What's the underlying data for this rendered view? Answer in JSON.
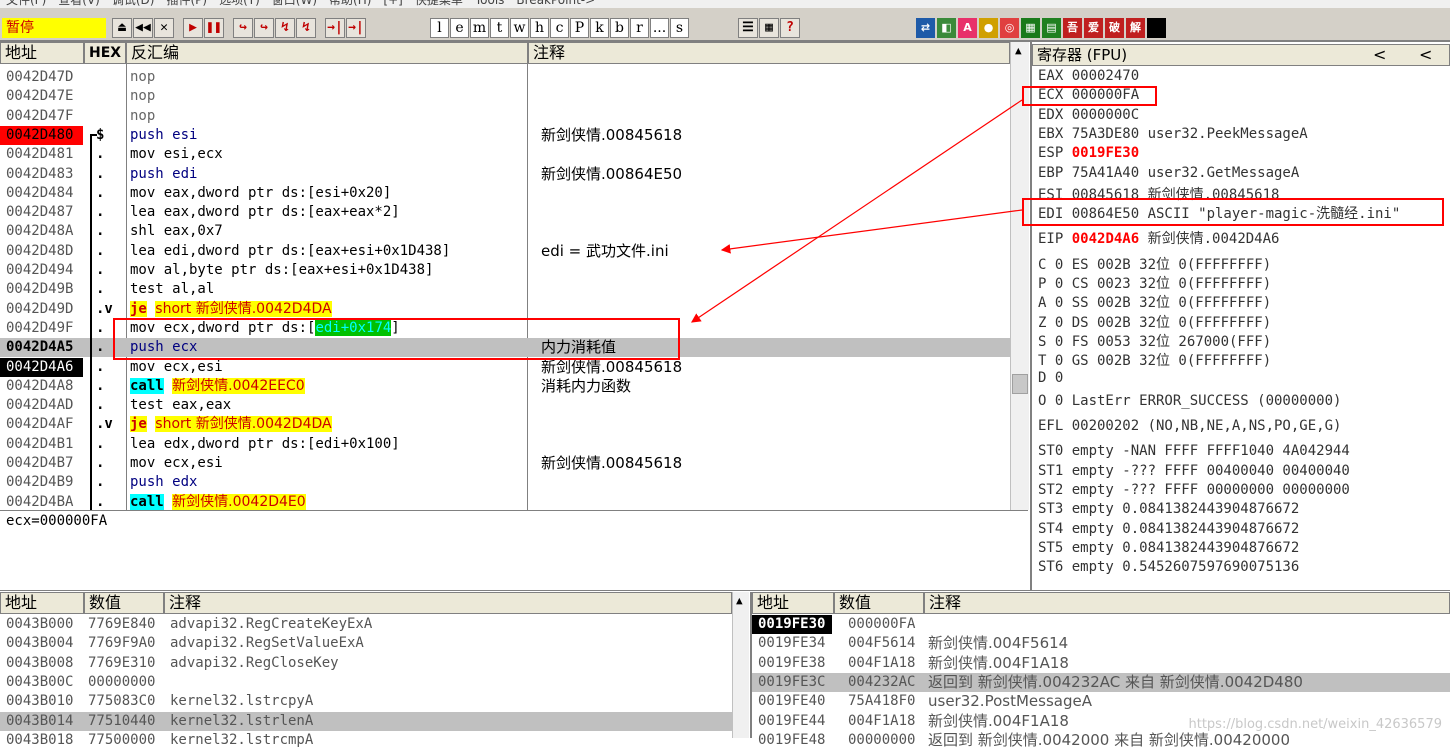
{
  "menubar": [
    "文件(F)",
    "查看(V)",
    "调试(D)",
    "插件(P)",
    "选项(T)",
    "窗口(W)",
    "帮助(H)",
    "[+]",
    "快捷菜单",
    "Tools",
    "BreakPoint->"
  ],
  "status": "暂停",
  "toolbar": {
    "nav": [
      "⏏",
      "◀◀",
      "✕",
      "▶",
      "❚❚",
      "↪",
      "↪",
      "↯",
      "↯",
      "→|",
      "→|"
    ],
    "letters": [
      "l",
      "e",
      "m",
      "t",
      "w",
      "h",
      "c",
      "P",
      "k",
      "b",
      "r",
      "...",
      "s"
    ],
    "misc": [
      "☰",
      "▦",
      "?"
    ],
    "plugins": [
      {
        "t": "⇄",
        "c": "#1e5aa8"
      },
      {
        "t": "◧",
        "c": "#3a8a3a"
      },
      {
        "t": "A",
        "c": "#e8306a"
      },
      {
        "t": "●",
        "c": "#d0a000"
      },
      {
        "t": "◎",
        "c": "#e04040"
      },
      {
        "t": "▦",
        "c": "#1a7a1a"
      },
      {
        "t": "▤",
        "c": "#208020"
      },
      {
        "t": "吾",
        "c": "#c02020"
      },
      {
        "t": "爱",
        "c": "#c02020"
      },
      {
        "t": "破",
        "c": "#c02020"
      },
      {
        "t": "解",
        "c": "#c02020"
      },
      {
        "t": "",
        "c": "#000000"
      }
    ]
  },
  "cpu": {
    "headers": {
      "addr": "地址",
      "hex": "HEX",
      "dis": "反汇编",
      "cmt": "注释"
    },
    "rows": [
      {
        "addr": "0042D47D",
        "hex": "",
        "dis": "nop",
        "cmt": "",
        "style": "gray"
      },
      {
        "addr": "0042D47E",
        "hex": "",
        "dis": "nop",
        "cmt": "",
        "style": "gray"
      },
      {
        "addr": "0042D47F",
        "hex": "",
        "dis": "nop",
        "cmt": "",
        "style": "gray"
      },
      {
        "addr": "0042D480",
        "hex": "$",
        "dis": "push esi",
        "cmt": "新剑侠情.00845618",
        "style": "bp"
      },
      {
        "addr": "0042D481",
        "hex": ".",
        "dis": "mov esi,ecx",
        "cmt": ""
      },
      {
        "addr": "0042D483",
        "hex": ".",
        "dis": "push edi",
        "cmt": "新剑侠情.00864E50"
      },
      {
        "addr": "0042D484",
        "hex": ".",
        "dis": "mov eax,dword ptr ds:[esi+0x20]",
        "cmt": ""
      },
      {
        "addr": "0042D487",
        "hex": ".",
        "dis": "lea eax,dword ptr ds:[eax+eax*2]",
        "cmt": ""
      },
      {
        "addr": "0042D48A",
        "hex": ".",
        "dis": "shl eax,0x7",
        "cmt": ""
      },
      {
        "addr": "0042D48D",
        "hex": ".",
        "dis": "lea edi,dword ptr ds:[eax+esi+0x1D438]",
        "cmt": "edi = 武功文件.ini"
      },
      {
        "addr": "0042D494",
        "hex": ".",
        "dis": "mov al,byte ptr ds:[eax+esi+0x1D438]",
        "cmt": ""
      },
      {
        "addr": "0042D49B",
        "hex": ".",
        "dis": "test al,al",
        "cmt": ""
      },
      {
        "addr": "0042D49D",
        "hex": ".v",
        "dis_kw": "je",
        "dis": "short 新剑侠情.0042D4DA",
        "cmt": "",
        "kind": "jump"
      },
      {
        "addr": "0042D49F",
        "hex": ".",
        "dis_pre": "mov ecx,dword ptr ds:[",
        "dis_hl": "edi+0x174",
        "dis_post": "]",
        "cmt": "",
        "kind": "hl"
      },
      {
        "addr": "0042D4A5",
        "hex": ".",
        "dis": "push ecx",
        "cmt": "内力消耗值",
        "style": "sel"
      },
      {
        "addr": "0042D4A6",
        "hex": ".",
        "dis": "mov ecx,esi",
        "cmt": "新剑侠情.00845618",
        "style": "eip"
      },
      {
        "addr": "0042D4A8",
        "hex": ".",
        "dis_kw": "call",
        "dis": "新剑侠情.0042EEC0",
        "cmt": "消耗内力函数",
        "kind": "call"
      },
      {
        "addr": "0042D4AD",
        "hex": ".",
        "dis": "test eax,eax",
        "cmt": ""
      },
      {
        "addr": "0042D4AF",
        "hex": ".v",
        "dis_kw": "je",
        "dis": "short 新剑侠情.0042D4DA",
        "cmt": "",
        "kind": "jump"
      },
      {
        "addr": "0042D4B1",
        "hex": ".",
        "dis": "lea edx,dword ptr ds:[edi+0x100]",
        "cmt": ""
      },
      {
        "addr": "0042D4B7",
        "hex": ".",
        "dis": "mov ecx,esi",
        "cmt": "新剑侠情.00845618"
      },
      {
        "addr": "0042D4B9",
        "hex": ".",
        "dis": "push edx",
        "cmt": ""
      },
      {
        "addr": "0042D4BA",
        "hex": ".",
        "dis_kw": "call",
        "dis": "新剑侠情.0042D4E0",
        "cmt": "",
        "kind": "call"
      }
    ],
    "info": "ecx=000000FA"
  },
  "registers": {
    "title": "寄存器 (FPU)",
    "nav": [
      "<",
      "<"
    ],
    "lines": [
      {
        "t": "EAX 00002470"
      },
      {
        "t": "ECX 000000FA"
      },
      {
        "t": "EDX 0000000C"
      },
      {
        "t": "EBX 75A3DE80 user32.PeekMessageA"
      },
      {
        "n": "ESP",
        "v": "0019FE30",
        "red": true
      },
      {
        "t": "EBP 75A41A40 user32.GetMessageA"
      },
      {
        "t": "ESI 00845618 新剑侠情.00845618"
      },
      {
        "t": "EDI 00864E50 ASCII \"player-magic-洗髓经.ini\""
      },
      {
        "n": "EIP",
        "v": "0042D4A6",
        "rest": "新剑侠情.0042D4A6",
        "red": true
      },
      {
        "t": "C 0  ES 002B 32位 0(FFFFFFFF)"
      },
      {
        "t": "P 0  CS 0023 32位 0(FFFFFFFF)"
      },
      {
        "t": "A 0  SS 002B 32位 0(FFFFFFFF)"
      },
      {
        "t": "Z 0  DS 002B 32位 0(FFFFFFFF)"
      },
      {
        "t": "S 0  FS 0053 32位 267000(FFF)"
      },
      {
        "t": "T 0  GS 002B 32位 0(FFFFFFFF)"
      },
      {
        "t": "D 0"
      },
      {
        "t": "O 0  LastErr ERROR_SUCCESS (00000000)"
      },
      {
        "t": "EFL 00200202 (NO,NB,NE,A,NS,PO,GE,G)"
      },
      {
        "t": "ST0 empty -NAN FFFF FFFF1040 4A042944"
      },
      {
        "t": "ST1 empty -??? FFFF 00400040 00400040"
      },
      {
        "t": "ST2 empty -??? FFFF 00000000 00000000"
      },
      {
        "t": "ST3 empty 0.0841382443904876672"
      },
      {
        "t": "ST4 empty 0.0841382443904876672"
      },
      {
        "t": "ST5 empty 0.0841382443904876672"
      },
      {
        "t": "ST6 empty 0.5452607597690075136"
      }
    ]
  },
  "dump": {
    "headers": {
      "addr": "地址",
      "val": "数值",
      "cmt": "注释"
    },
    "rows": [
      {
        "addr": "0043B000",
        "val": "7769E840",
        "cmt": "advapi32.RegCreateKeyExA"
      },
      {
        "addr": "0043B004",
        "val": "7769F9A0",
        "cmt": "advapi32.RegSetValueExA"
      },
      {
        "addr": "0043B008",
        "val": "7769E310",
        "cmt": "advapi32.RegCloseKey"
      },
      {
        "addr": "0043B00C",
        "val": "00000000",
        "cmt": ""
      },
      {
        "addr": "0043B010",
        "val": "775083C0",
        "cmt": "kernel32.lstrcpyA"
      },
      {
        "addr": "0043B014",
        "val": "77510440",
        "cmt": "kernel32.lstrlenA",
        "sel": true
      },
      {
        "addr": "0043B018",
        "val": "77500000",
        "cmt": "kernel32.lstrcmpA"
      }
    ]
  },
  "stack": {
    "headers": {
      "addr": "地址",
      "val": "数值",
      "cmt": "注释"
    },
    "rows": [
      {
        "addr": "0019FE30",
        "val": "000000FA",
        "cmt": "",
        "top": true
      },
      {
        "addr": "0019FE34",
        "val": "004F5614",
        "cmt": "新剑侠情.004F5614"
      },
      {
        "addr": "0019FE38",
        "val": "004F1A18",
        "cmt": "新剑侠情.004F1A18"
      },
      {
        "addr": "0019FE3C",
        "val": "004232AC",
        "cmt": "返回到 新剑侠情.004232AC 来自 新剑侠情.0042D480",
        "sel": true
      },
      {
        "addr": "0019FE40",
        "val": "75A418F0",
        "cmt": "user32.PostMessageA"
      },
      {
        "addr": "0019FE44",
        "val": "004F1A18",
        "cmt": "新剑侠情.004F1A18"
      },
      {
        "addr": "0019FE48",
        "val": "00000000",
        "cmt": "返回到 新剑侠情.0042000 来自 新剑侠情.00420000"
      }
    ]
  },
  "watermark": "https://blog.csdn.net/weixin_42636579"
}
